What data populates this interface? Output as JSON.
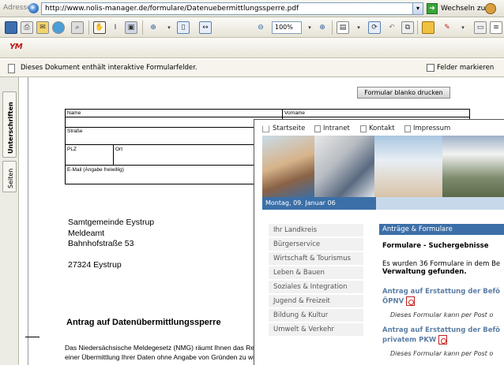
{
  "address_bar": {
    "label": "Adresse",
    "url": "http://www.nolis-manager.de/formulare/Datenuebermittlungssperre.pdf",
    "go_label": "Wechseln zu"
  },
  "toolbar": {
    "zoom": "100%"
  },
  "form_bar": {
    "notice": "Dieses Dokument enthält interaktive Formularfelder.",
    "highlight_fields_label": "Felder markieren"
  },
  "side_tabs": {
    "signatures": "Unterschriften",
    "pages": "Seiten"
  },
  "pdf": {
    "print_button": "Formular blanko drucken",
    "fields": {
      "name": "Name",
      "vorname": "Vorname",
      "strasse": "Straße",
      "plz": "PLZ",
      "ort": "Ort",
      "email": "E-Mail  (Angabe freiwillig)"
    },
    "address": [
      "Samtgemeinde Eystrup",
      "Meldeamt",
      "Bahnhofstraße 53",
      "27324 Eystrup"
    ],
    "title": "Antrag auf Datenübermittlungssperre",
    "body_lines": [
      "Das Niedersächsische Meldegesetz (NMG) räumt Ihnen das Recht ein, einer",
      "einer Übermittlung Ihrer Daten ohne Angabe von Gründen zu widersprechen."
    ]
  },
  "website": {
    "nav": [
      "Startseite",
      "Intranet",
      "Kontakt",
      "Impressum"
    ],
    "date": "Montag, 09. Januar 06",
    "menu": [
      "Ihr Landkreis",
      "Bürgerservice",
      "Wirtschaft & Tourismus",
      "Leben & Bauen",
      "Soziales & Integration",
      "Jugend & Freizeit",
      "Bildung & Kultur",
      "Umwelt & Verkehr"
    ],
    "content_header": "Anträge & Formulare",
    "content_title": "Formulare - Suchergebnisse",
    "result_line1": "Es wurden 36 Formulare in dem Be",
    "result_line2": "Verwaltung gefunden.",
    "entries": [
      {
        "title_1": "Antrag auf Erstattung der Befö",
        "title_2": "ÖPNV",
        "note": "Dieses Formular kann per Post o"
      },
      {
        "title_1": "Antrag auf Erstattung der Befö",
        "title_2": "privatem PKW",
        "note": "Dieses Formular kann per Post o"
      }
    ]
  },
  "colors": {
    "accent_blue": "#3c6fa8",
    "link_blue": "#5b7ea5",
    "logo_red": "#c01818"
  },
  "logo_text": "YM"
}
